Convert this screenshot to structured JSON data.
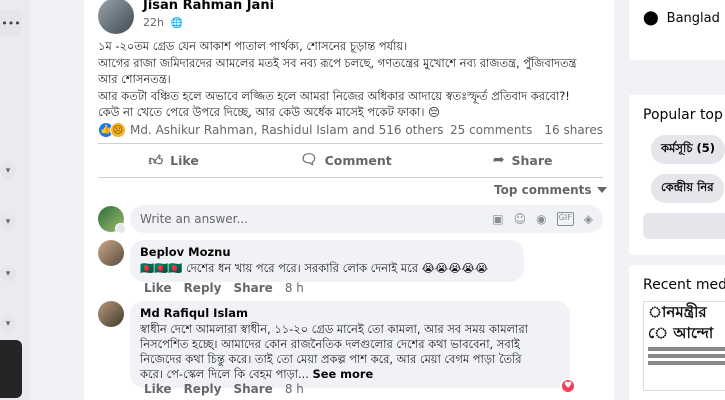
{
  "left_rail": {
    "more_icon": "ellipsis-icon"
  },
  "post": {
    "author": "Jisan Rahman Jani",
    "time": "22h",
    "privacy_icon": "globe-icon",
    "body_lines": [
      "১ম -২০তম গ্রেড যেন আকাশ পাতাল পার্থক্য, শোসনের চূড়ান্ত পর্যায়।",
      "আগের রাজা জমিদারদের আমলের মতই সব নব্য রূপে চলছে, গণতন্ত্রের মুখোশে নব্য রাজতন্ত্র,  পুঁজিবাদতন্ত্র",
      "আর শোসনতন্ত্র।",
      "আর কতটা বঞ্চিত হলে অভাবে লজ্জিত হলে আমরা নিজের অধিকার আদায়ে স্বতঃস্ফূর্ত প্রতিবাদ করবো?!",
      "কেউ না খেতে পেরে উপরে দিচ্ছে, আর কেউ অর্ধেক মাসেই পকেট ফাকা। 😔"
    ],
    "reactions_text": "Md. Ashikur Rahman, Rashidul Islam and 516 others",
    "comments_count": "25 comments",
    "shares_count": "16 shares",
    "actions": {
      "like": "Like",
      "comment": "Comment",
      "share": "Share"
    },
    "sort_label": "Top comments",
    "compose_placeholder": "Write an answer...",
    "compose_icons": [
      "sticker-icon",
      "emoji-icon",
      "camera-icon",
      "gif-icon",
      "sticker-pack-icon"
    ]
  },
  "comments": [
    {
      "name": "Beplov Moznu",
      "text": "🇧🇩🇧🇩🇧🇩 দেশের ধন খায় পরে পরে।  সরকারি লোক দেনাই মরে 😭😭😭😭😭",
      "like": "Like",
      "reply": "Reply",
      "share": "Share",
      "time": "8 h"
    },
    {
      "name": "Md Rafiqul Islam",
      "lines": [
        "স্বাধীন দেশে আমলারা স্বাধীন, ১১-২০ গ্রেড মানেই তো কামলা, আর সব সময় কামলারা",
        "নিসপেশিত হচ্ছে।  আমাদের কোন রাজনৈতিক দলগুলোর দেশের কথা ভাববেনা, সবাই",
        "নিজেদের কথা চিন্তু করে।  তাই তো মেয়া প্রকল্প পাশ করে, আর মেয়া বেগম পাড়া তৈরি",
        "করে। পে-স্কেল দিলে কি বেহম পাড়া... "
      ],
      "see_more": "See more",
      "like": "Like",
      "reply": "Reply",
      "share": "Share",
      "time": "8 h"
    }
  ],
  "sidebar": {
    "location": "Banglad",
    "popular_title": "Popular top",
    "topics": [
      "কর্মসূচি (5)",
      "কেন্দ্রীয় নির"
    ],
    "recent_title": "Recent med",
    "news_lines": [
      "ানমন্ত্রীর",
      "ে আন্দো"
    ]
  }
}
